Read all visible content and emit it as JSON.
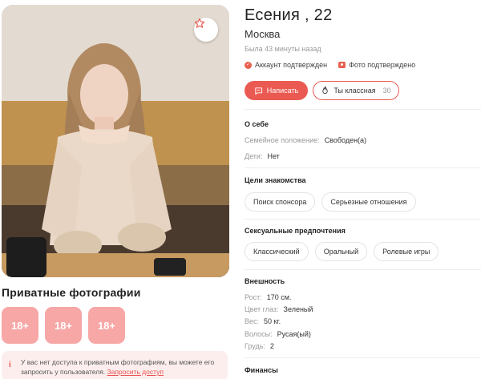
{
  "profile": {
    "name": "Есения , 22",
    "city": "Москва",
    "last_seen": "Была 43 минуты назад",
    "verified_account": "Аккаунт подтвержден",
    "verified_photo": "Фото подтверждено",
    "accent_color": "#ea5a52"
  },
  "actions": {
    "write_label": "Написать",
    "cool_label": "Ты классная",
    "cool_count": "30"
  },
  "about": {
    "title": "О себе",
    "items": [
      {
        "key": "Семейное положение:",
        "value": "Свободен(а)"
      },
      {
        "key": "Дети:",
        "value": "Нет"
      }
    ]
  },
  "goals": {
    "title": "Цели знакомства",
    "chips": [
      "Поиск спонсора",
      "Серьезные отношения"
    ]
  },
  "preferences": {
    "title": "Сексуальные предпочтения",
    "chips": [
      "Классический",
      "Оральный",
      "Ролевые игры"
    ]
  },
  "appearance": {
    "title": "Внешность",
    "items": [
      {
        "key": "Рост:",
        "value": "170 см."
      },
      {
        "key": "Цвет глаз:",
        "value": "Зеленый"
      },
      {
        "key": "Вес:",
        "value": "50 кг."
      },
      {
        "key": "Волосы:",
        "value": "Русая(ый)"
      },
      {
        "key": "Грудь:",
        "value": "2"
      }
    ]
  },
  "finance": {
    "title": "Финансы"
  },
  "private_photos": {
    "title": "Приватные фотографии",
    "thumbs": [
      "18+",
      "18+",
      "18+"
    ],
    "note": "У вас нет доступа к приватным фотографиям, вы можете его запросить у пользователя.",
    "request_link": "Запросить доступ",
    "info_icon": "i"
  },
  "icons": {
    "favorite": "star-icon",
    "write": "chat-icon",
    "cool": "flame-icon",
    "verify": "check-icon",
    "photo": "camera-icon"
  }
}
